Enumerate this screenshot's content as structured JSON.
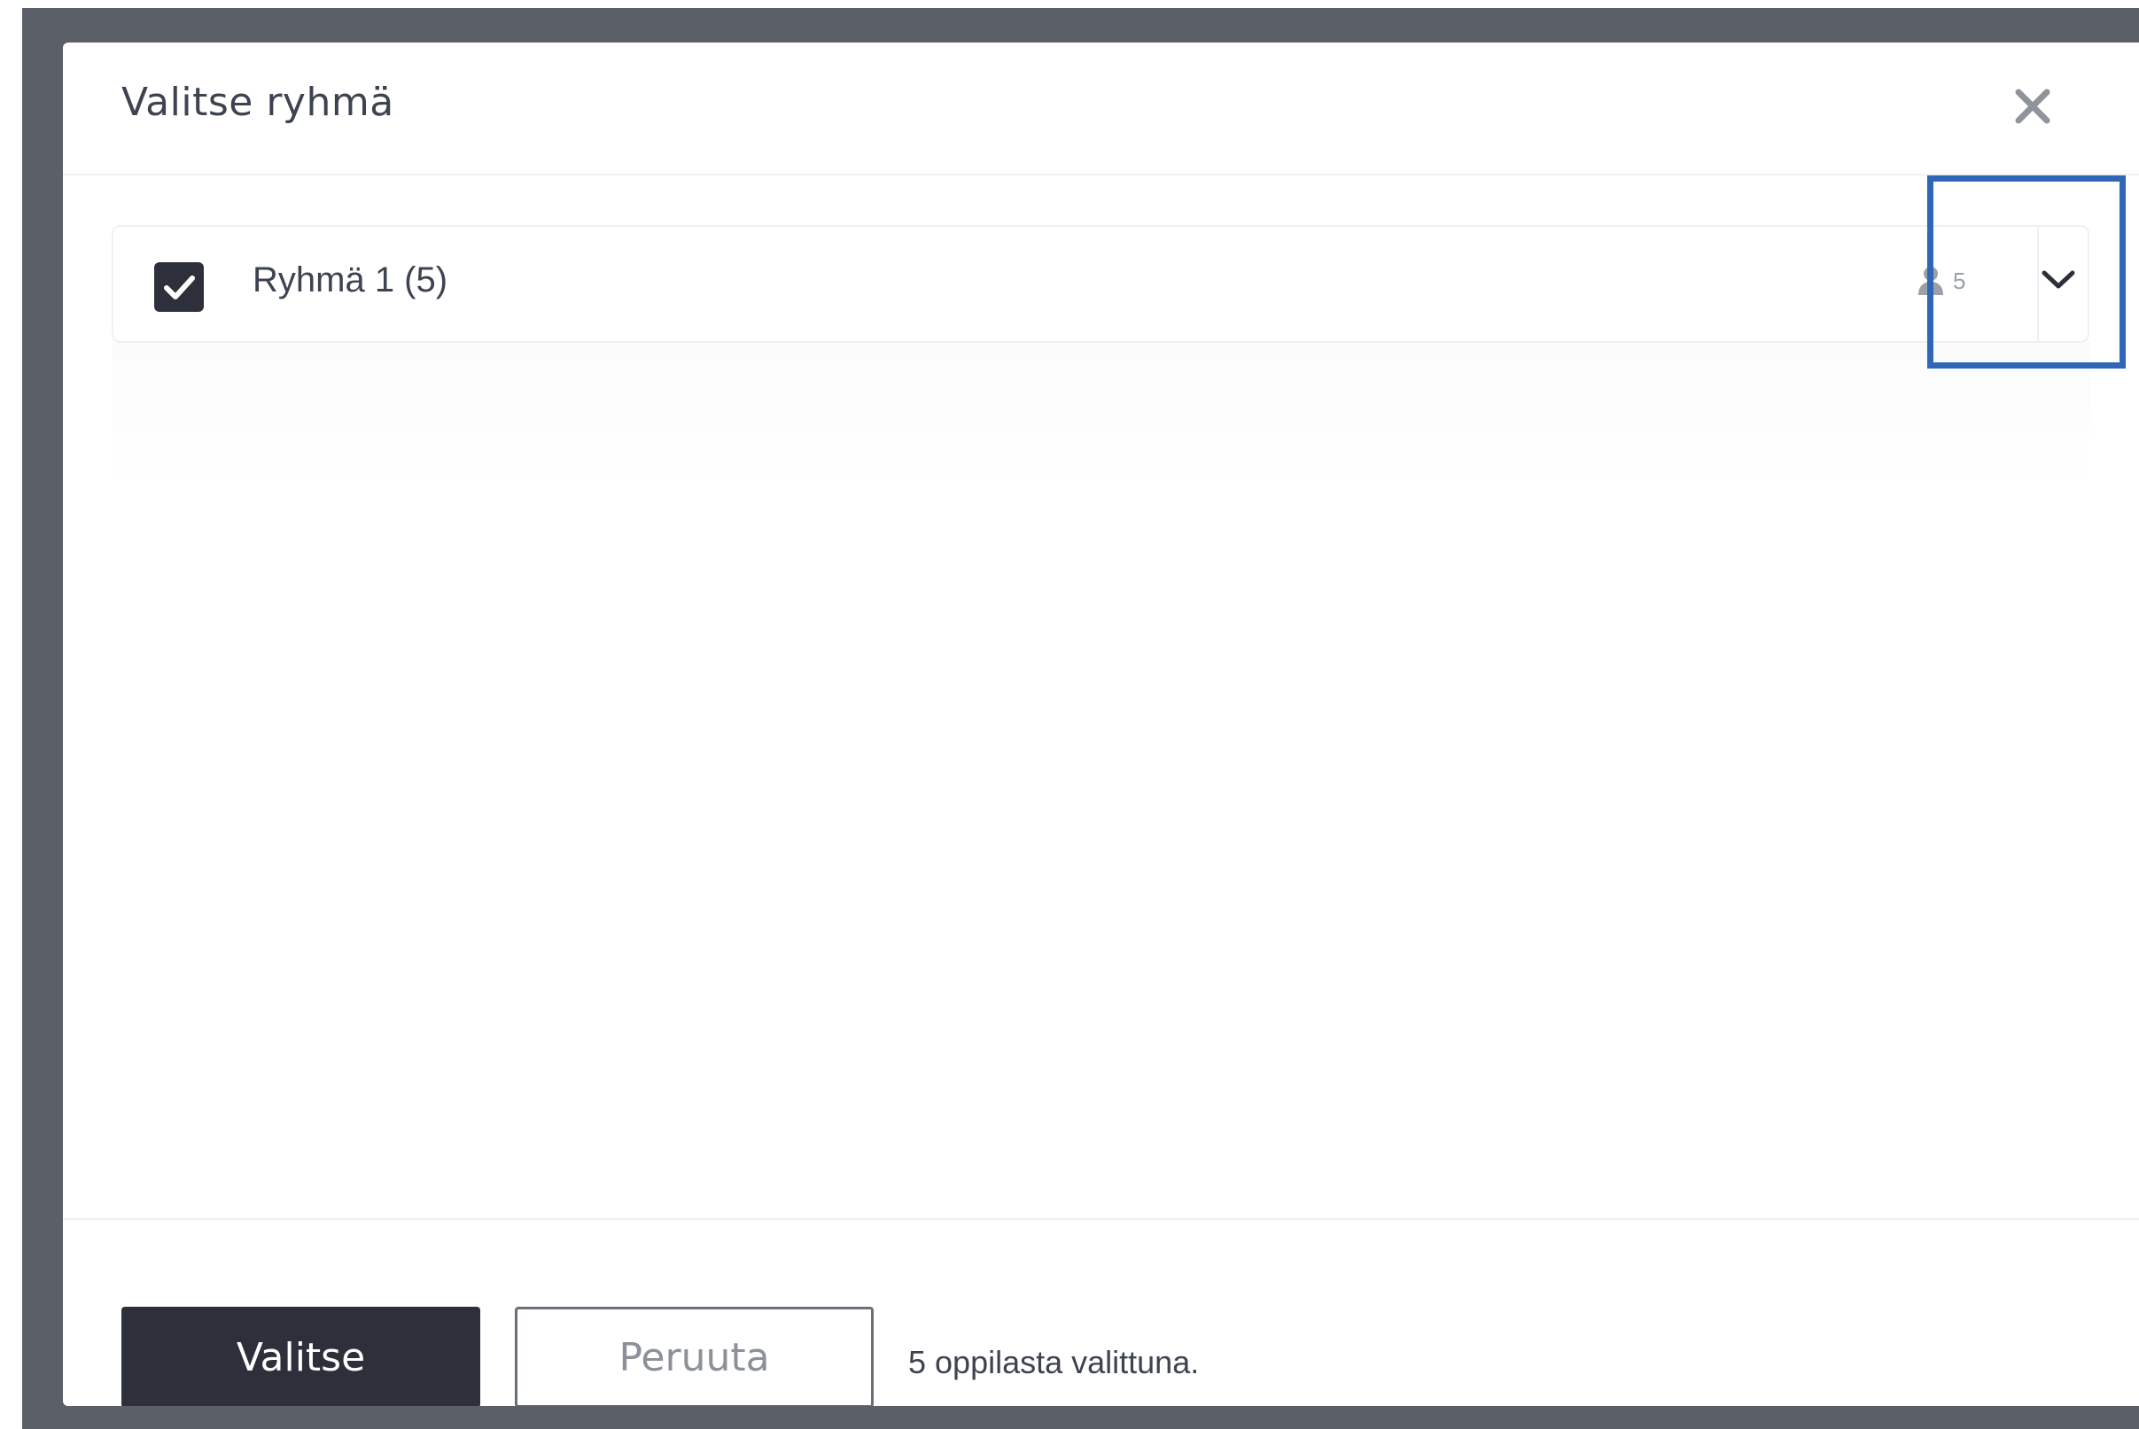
{
  "dialog": {
    "title": "Valitse ryhmä"
  },
  "group": {
    "name": "Ryhmä 1 (5)",
    "checked": true,
    "member_count": "5"
  },
  "footer": {
    "select_label": "Valitse",
    "cancel_label": "Peruuta",
    "selected_text": "5 oppilasta valittuna."
  },
  "icons": {
    "close": "close-icon",
    "checkbox": "checkmark-icon",
    "members": "person-icon",
    "expand": "chevron-down-icon"
  },
  "colors": {
    "overlay": "#5b5f68",
    "primary_button": "#2d303b",
    "text": "#3d4350",
    "muted": "#9ba0a8",
    "highlight": "#2f66b5"
  }
}
